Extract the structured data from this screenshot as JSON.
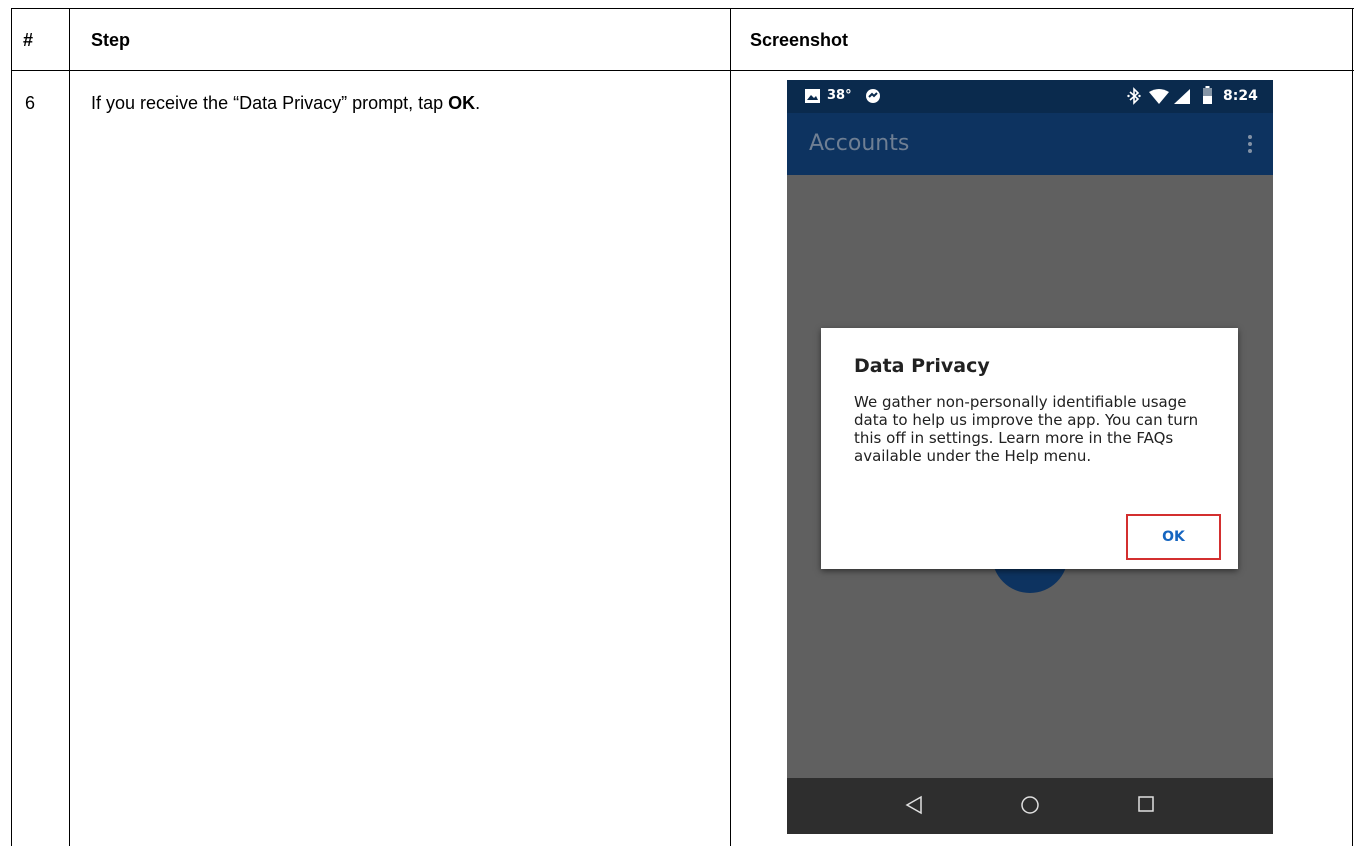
{
  "table": {
    "headers": {
      "num": "#",
      "step": "Step",
      "screenshot": "Screenshot"
    },
    "row": {
      "num": "6",
      "step_prefix": "If you receive the “Data Privacy” prompt, tap ",
      "step_bold": "OK",
      "step_suffix": "."
    }
  },
  "phone": {
    "status": {
      "temperature": "38°",
      "time": "8:24"
    },
    "app_title": "Accounts",
    "dialog": {
      "title": "Data Privacy",
      "body": "We gather non-personally identifiable usage data to help us improve the app. You can turn this off in settings. Learn more in the FAQs available under the Help menu.",
      "ok_label": "OK"
    },
    "colors": {
      "appbar": "#0d3360",
      "statusbar": "#0a2a4d",
      "ok_text": "#1565c0",
      "highlight": "#d32f2f"
    },
    "icons": [
      "image-icon",
      "sync-icon",
      "bluetooth-icon",
      "wifi-icon",
      "signal-icon",
      "battery-icon",
      "overflow-menu-icon",
      "back-icon",
      "home-icon",
      "recents-icon"
    ]
  }
}
